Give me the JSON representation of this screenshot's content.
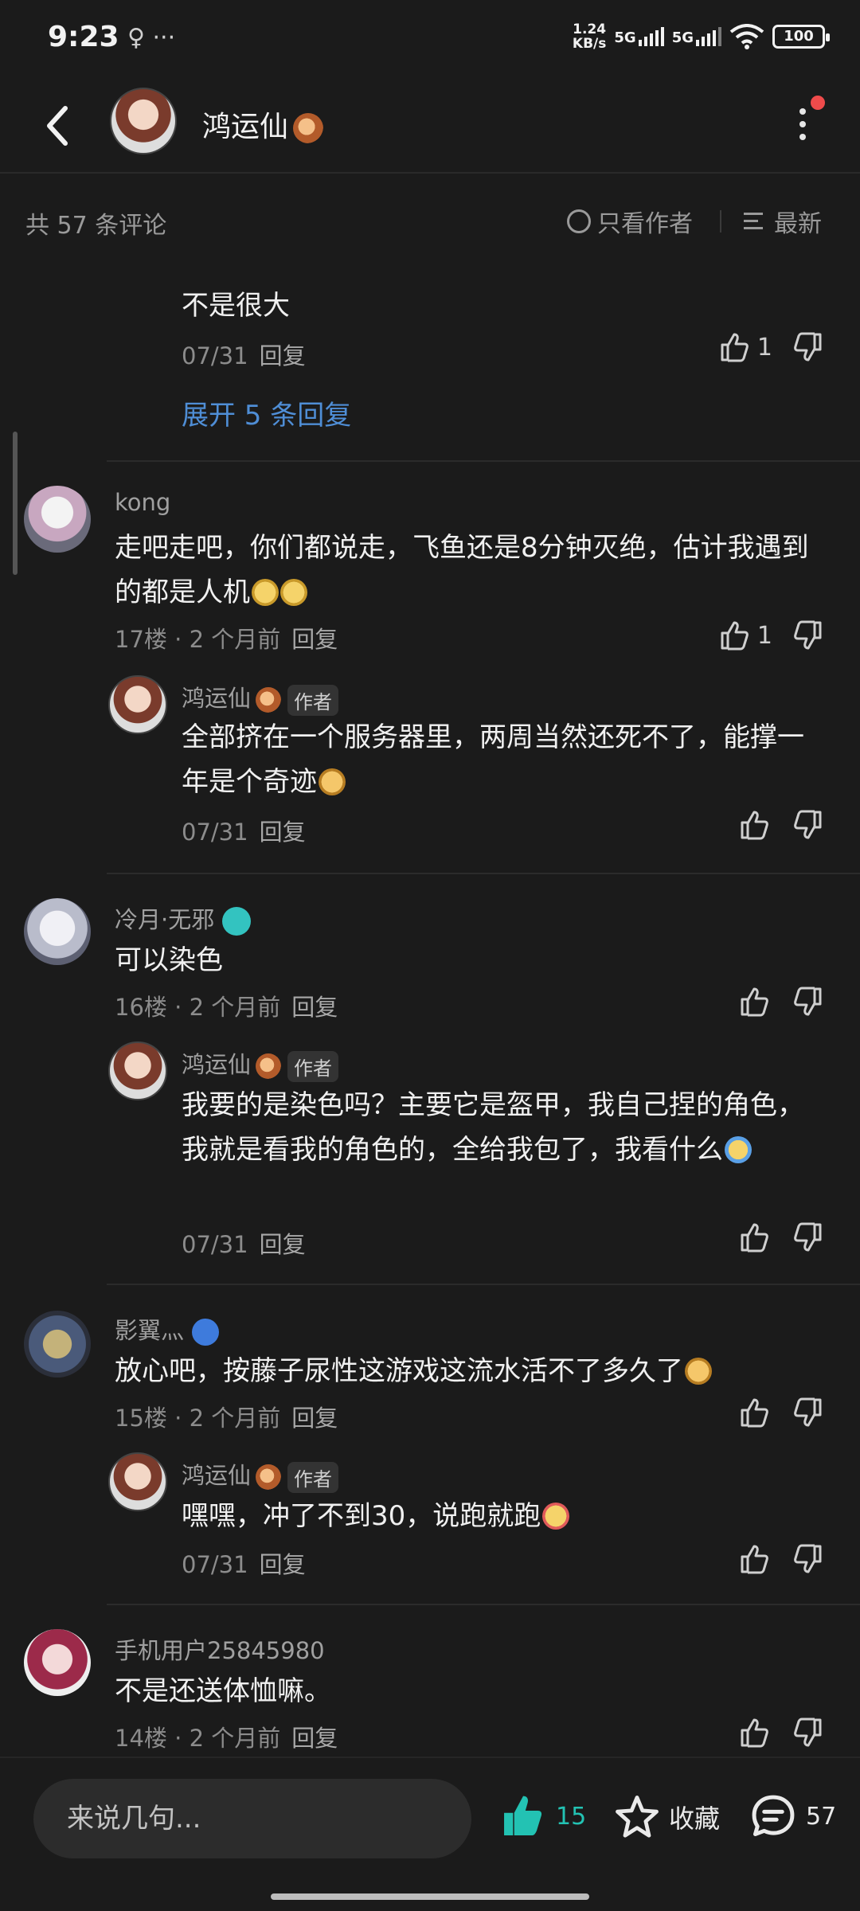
{
  "status_bar": {
    "time": "9:23",
    "left_icons": "♀ ···",
    "speed_top": "1.24",
    "speed_unit": "KB/s",
    "net1": "5G",
    "net2": "5G",
    "battery": "100"
  },
  "header": {
    "title": "鸿运仙"
  },
  "filter": {
    "count": "共 57 条评论",
    "only_author": "只看作者",
    "sort": "最新"
  },
  "top_thread": {
    "text": "不是很大",
    "date": "07/31",
    "reply": "回复",
    "likes": "1",
    "expand": "展开 5 条回复"
  },
  "comments": [
    {
      "name": "kong",
      "text": "走吧走吧，你们都说走，飞鱼还是8分钟灭绝，估计我遇到的都是人机",
      "floor": "17楼",
      "time": "2 个月前",
      "reply": "回复",
      "likes": "1",
      "sub": {
        "name": "鸿运仙",
        "tag": "作者",
        "text": "全部挤在一个服务器里，两周当然还死不了，能撑一年是个奇迹",
        "date": "07/31",
        "reply": "回复"
      }
    },
    {
      "name": "冷月·无邪",
      "text": "可以染色",
      "floor": "16楼",
      "time": "2 个月前",
      "reply": "回复",
      "sub": {
        "name": "鸿运仙",
        "tag": "作者",
        "text": "我要的是染色吗？主要它是盔甲，我自己捏的角色，我就是看我的角色的，全给我包了，我看什么",
        "date": "07/31",
        "reply": "回复"
      }
    },
    {
      "name": "影翼灬",
      "text": "放心吧，按藤子尿性这游戏这流水活不了多久了",
      "floor": "15楼",
      "time": "2 个月前",
      "reply": "回复",
      "sub": {
        "name": "鸿运仙",
        "tag": "作者",
        "text": "嘿嘿，冲了不到30，说跑就跑",
        "date": "07/31",
        "reply": "回复"
      }
    },
    {
      "name": "手机用户25845980",
      "text": "不是还送体恤嘛。",
      "floor": "14楼",
      "time": "2 个月前",
      "reply": "回复"
    }
  ],
  "bottom": {
    "placeholder": "来说几句...",
    "likes": "15",
    "favorite": "收藏",
    "comments": "57"
  },
  "colors": {
    "accent_blue": "#4f8ed6",
    "like_teal": "#23c2b3",
    "notify_red": "#ef4b4b"
  }
}
